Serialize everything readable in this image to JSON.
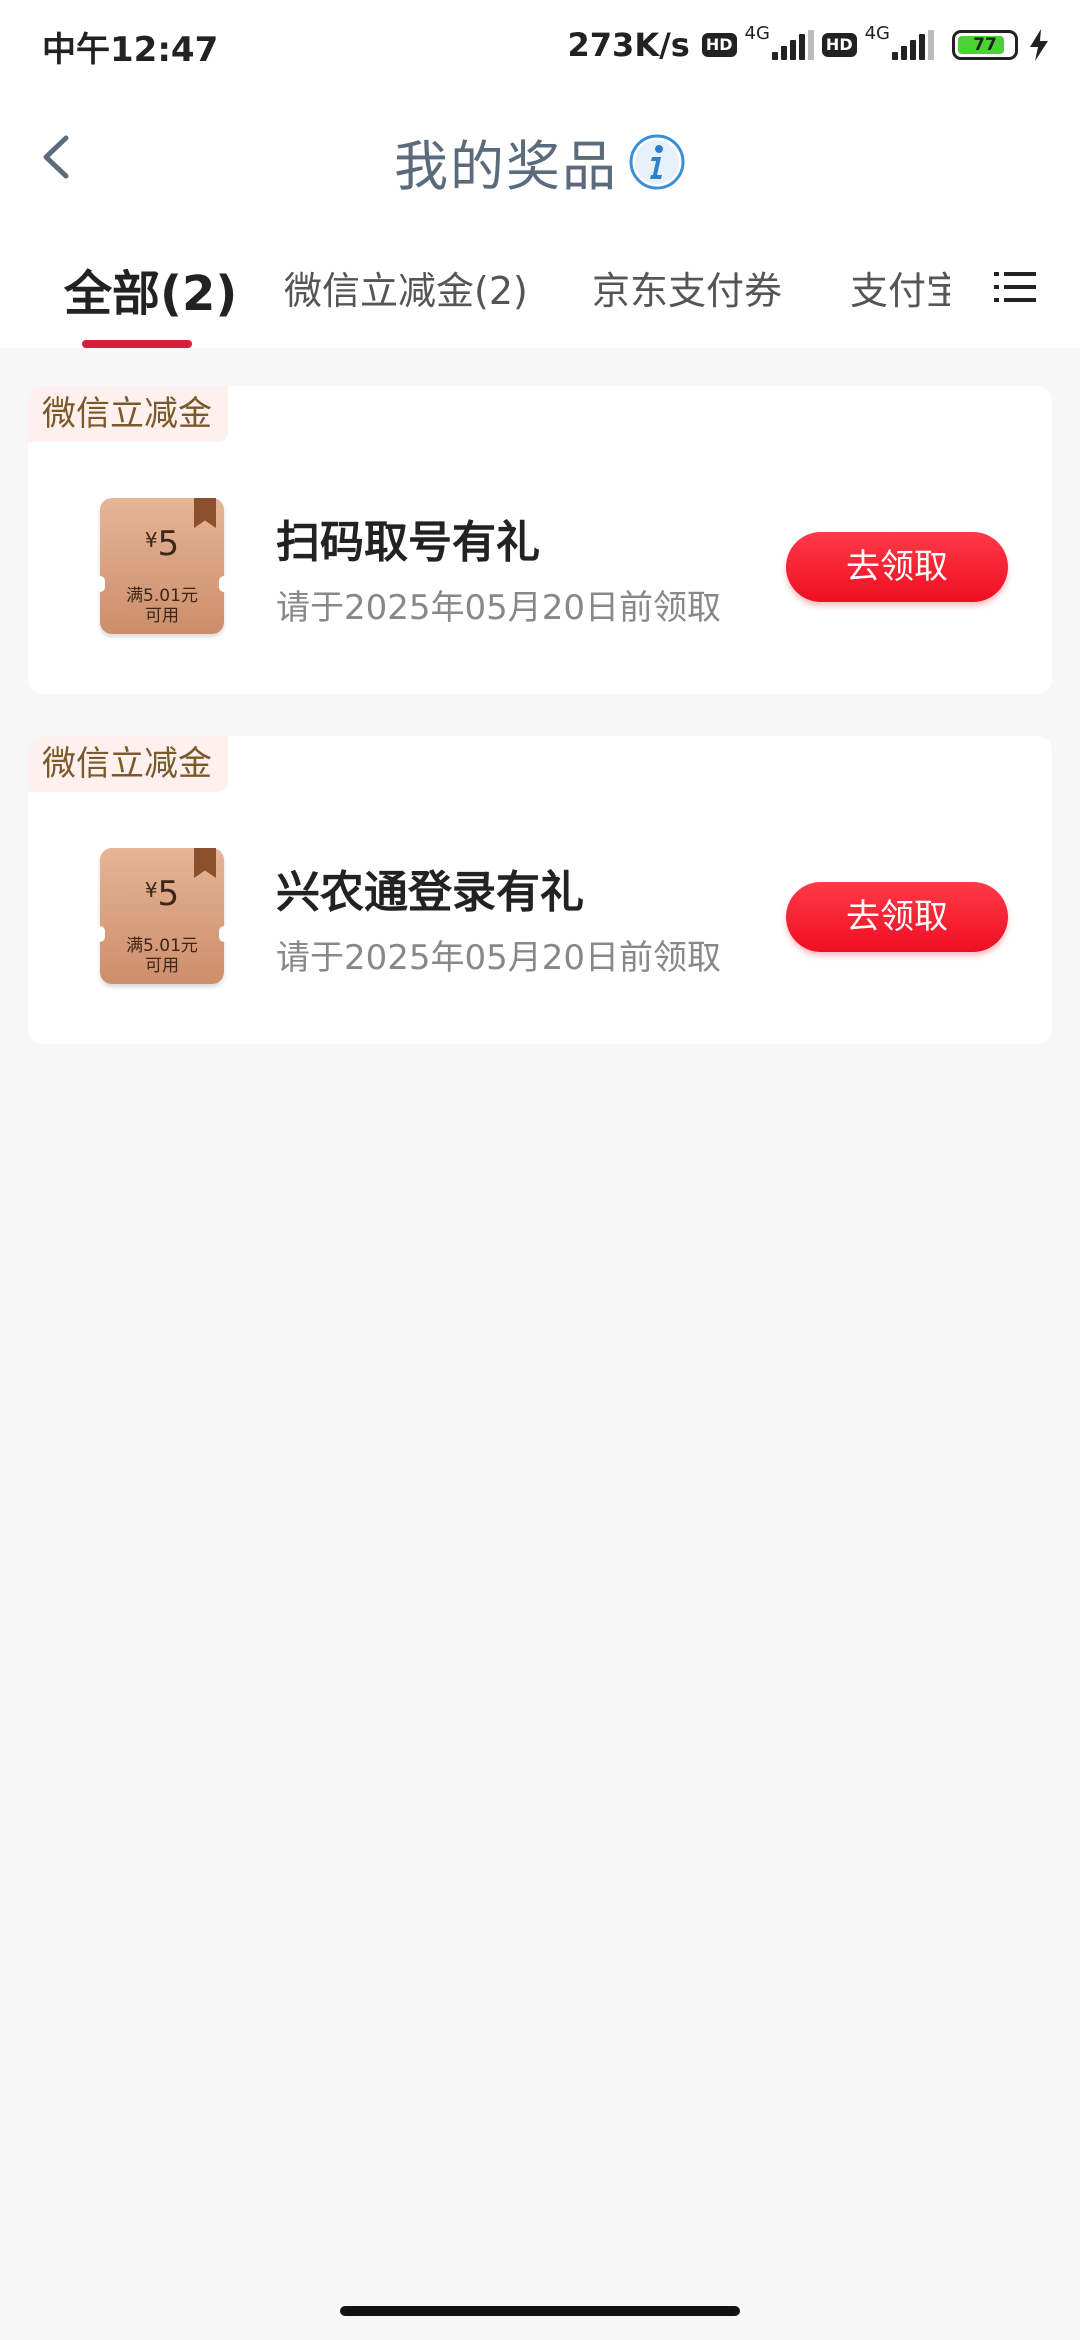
{
  "status_bar": {
    "time": "中午12:47",
    "net_speed": "273K/s",
    "hd_label": "HD",
    "net_type": "4G",
    "battery_level": "77"
  },
  "header": {
    "title": "我的奖品",
    "back_icon": "chevron-left-icon",
    "info_icon": "info-circle-icon"
  },
  "tabs": [
    {
      "label": "全部(2)",
      "active": true
    },
    {
      "label": "微信立减金(2)",
      "active": false
    },
    {
      "label": "京东支付券",
      "active": false
    },
    {
      "label": "支付宝",
      "active": false
    }
  ],
  "menu_icon": "list-menu-icon",
  "cards": [
    {
      "tag": "微信立减金",
      "coupon_symbol": "¥",
      "coupon_amount": "5",
      "coupon_condition_line1": "满5.01元",
      "coupon_condition_line2": "可用",
      "title": "扫码取号有礼",
      "deadline": "请于2025年05月20日前领取",
      "button": "去领取"
    },
    {
      "tag": "微信立减金",
      "coupon_symbol": "¥",
      "coupon_amount": "5",
      "coupon_condition_line1": "满5.01元",
      "coupon_condition_line2": "可用",
      "title": "兴农通登录有礼",
      "deadline": "请于2025年05月20日前领取",
      "button": "去领取"
    }
  ],
  "colors": {
    "accent": "#d81e3a",
    "button_red": "#f01428",
    "tag_bg": "#fdf0ef",
    "tag_text": "#7a5a28",
    "coupon": "#d99e7c"
  }
}
